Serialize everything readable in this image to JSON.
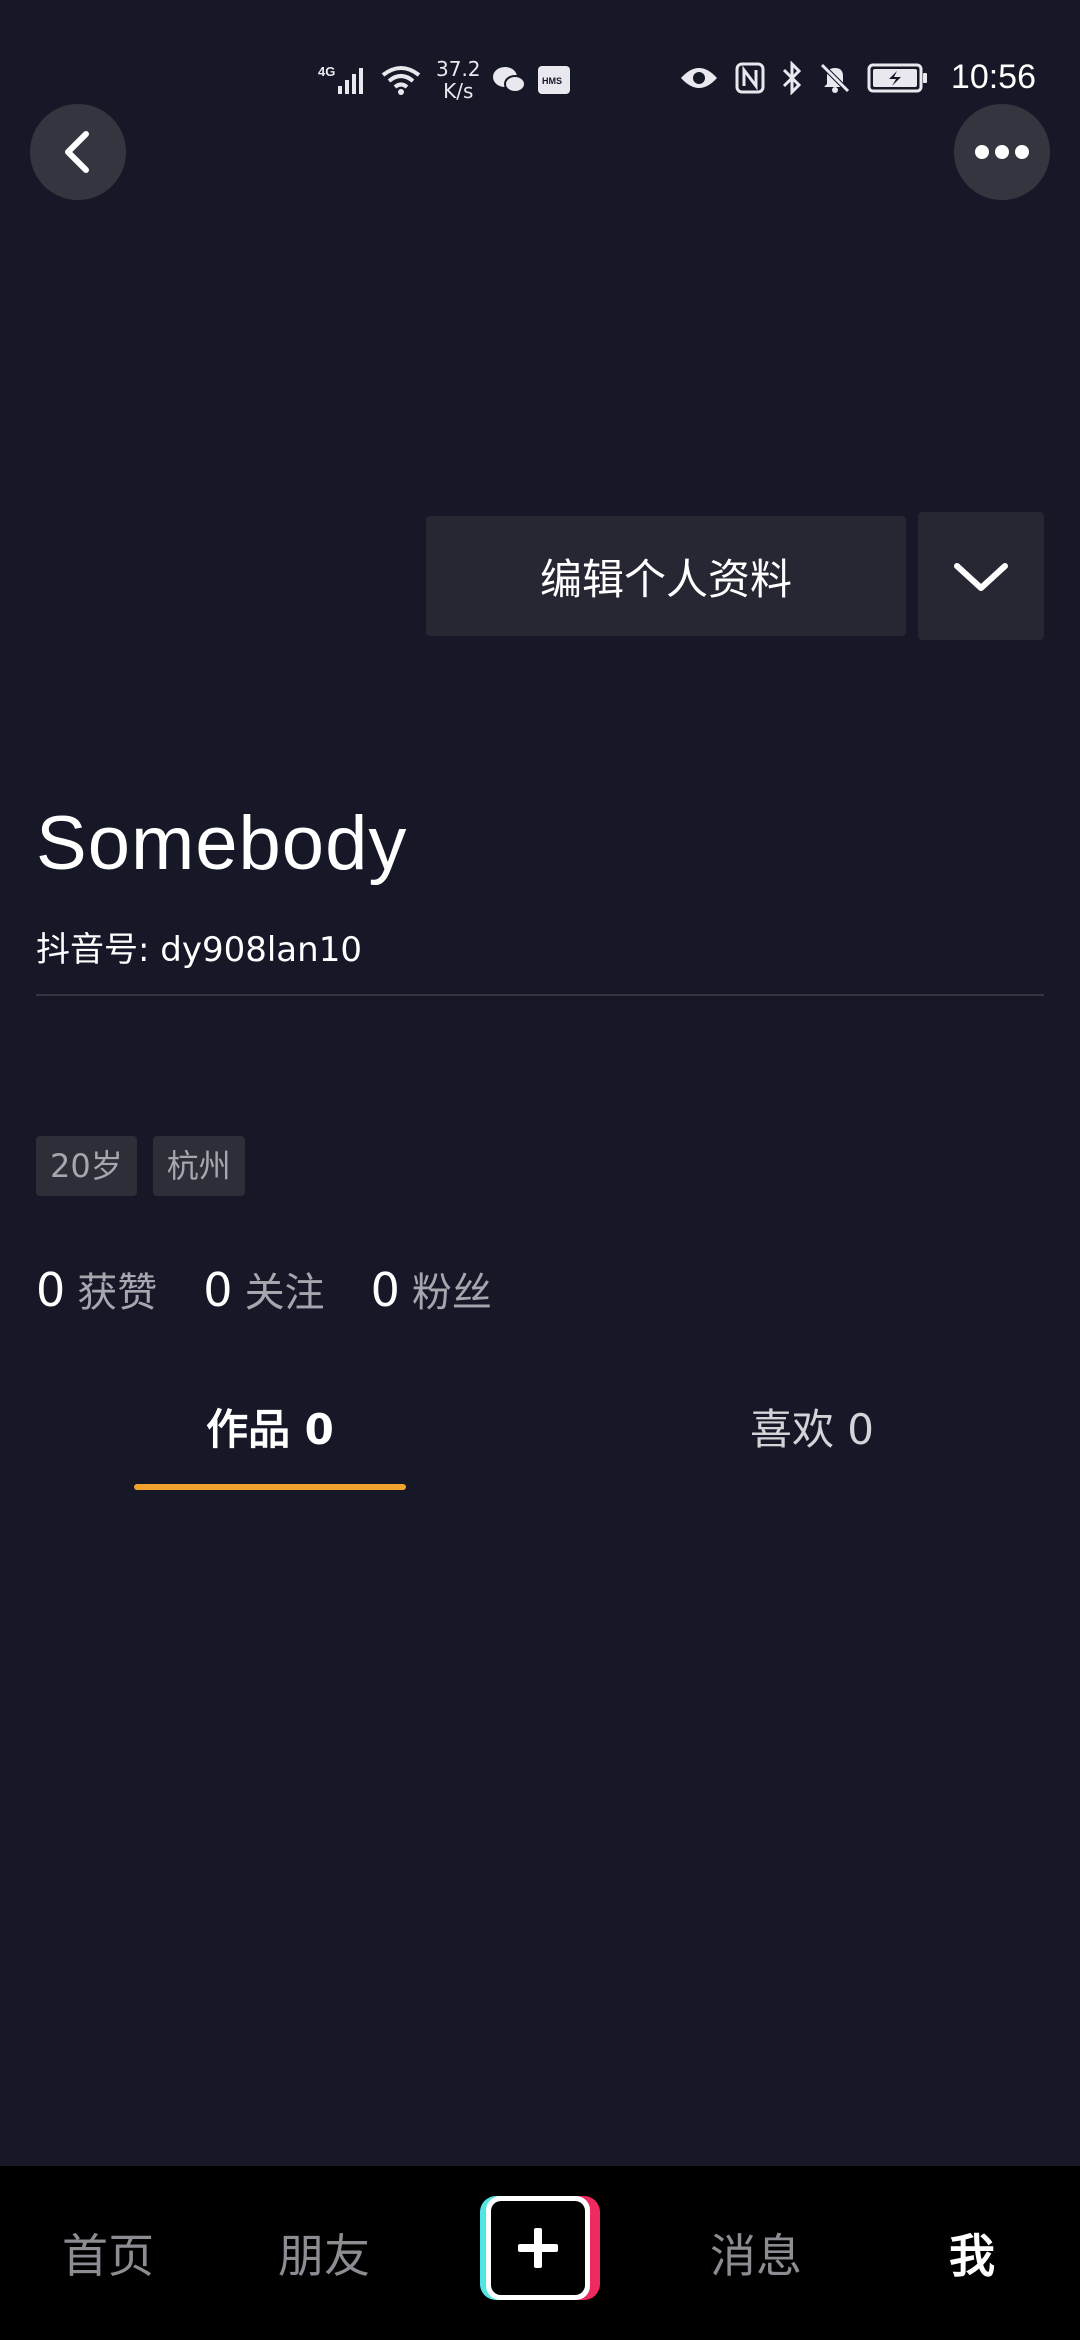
{
  "status_bar": {
    "network_type": "4G",
    "speed_value": "37.2",
    "speed_unit": "K/s",
    "time": "10:56",
    "icons": [
      "signal-icon",
      "wifi-icon",
      "wechat-icon",
      "hms-icon",
      "eye-icon",
      "nfc-icon",
      "bluetooth-icon",
      "mute-icon",
      "battery-icon"
    ]
  },
  "header": {
    "back_icon": "chevron-left-icon",
    "more_icon": "more-dots-icon"
  },
  "profile": {
    "edit_label": "编辑个人资料",
    "dropdown_icon": "chevron-down-icon",
    "name": "Somebody",
    "douyin_id": "抖音号: dy908lan10",
    "tags": [
      "20岁",
      "杭州"
    ],
    "stats": [
      {
        "count": "0",
        "label": "获赞"
      },
      {
        "count": "0",
        "label": "关注"
      },
      {
        "count": "0",
        "label": "粉丝"
      }
    ]
  },
  "tabs": {
    "works": "作品 0",
    "likes": "喜欢 0",
    "active": "works",
    "accent_color": "#f0a12e"
  },
  "bottom_nav": {
    "home": "首页",
    "friends": "朋友",
    "create_icon": "plus-icon",
    "messages": "消息",
    "me": "我",
    "active": "me"
  },
  "colors": {
    "background": "#171827",
    "button_bg": "#262733",
    "nav_bg": "#000000"
  }
}
